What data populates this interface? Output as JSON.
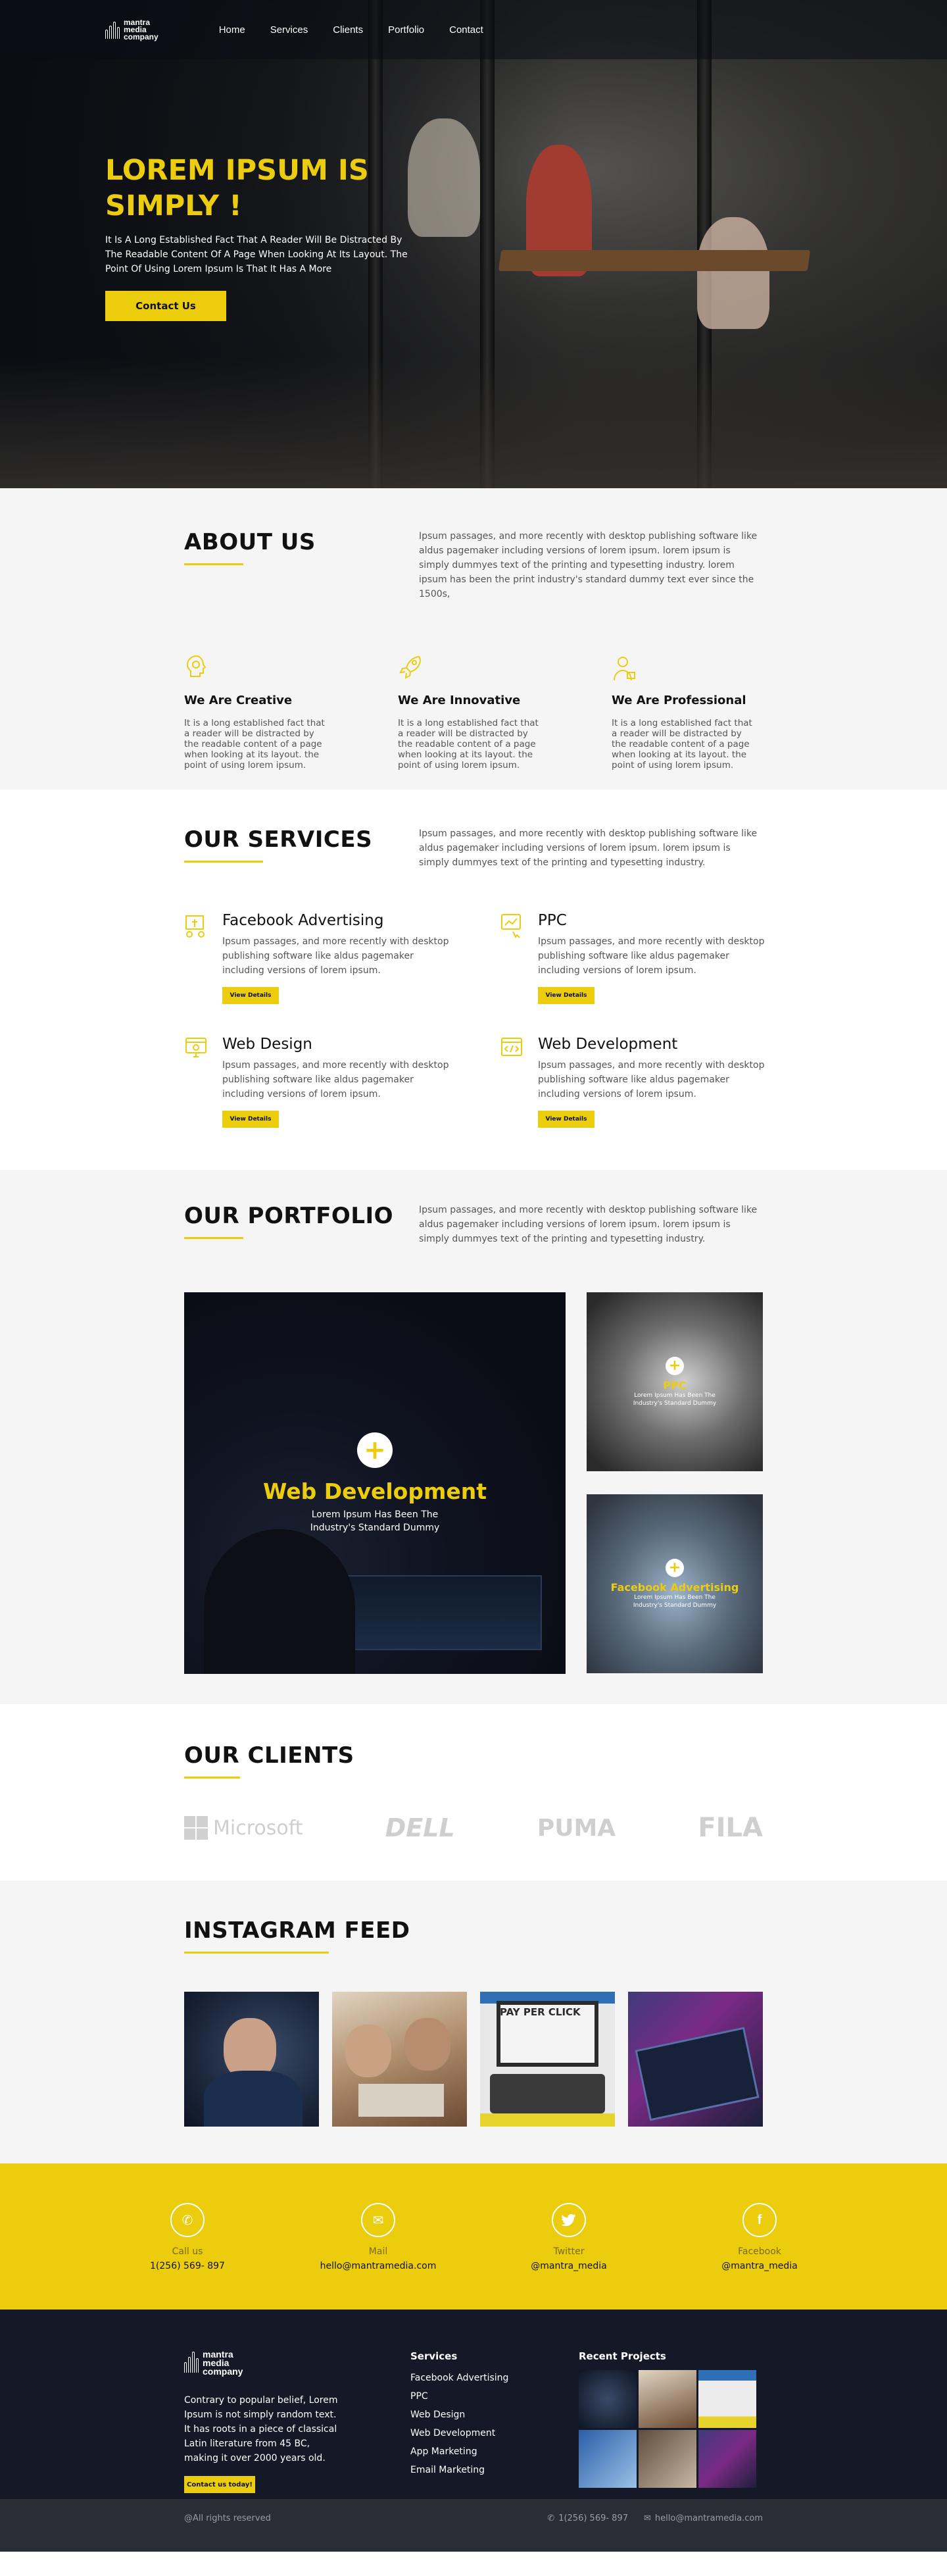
{
  "brand": {
    "logo_line1": "mantra",
    "logo_line2": "media",
    "logo_line3": "company"
  },
  "nav": {
    "items": [
      "Home",
      "Services",
      "Clients",
      "Portfolio",
      "Contact"
    ]
  },
  "hero": {
    "title_line1": "LOREM IPSUM IS",
    "title_line2": "SIMPLY !",
    "text": "It Is A Long Established Fact That A Reader Will Be Distracted By The Readable Content Of A Page When Looking At Its Layout. The Point Of Using Lorem Ipsum Is That It Has A More",
    "button": "Contact Us"
  },
  "about": {
    "title": "ABOUT US",
    "desc": "Ipsum passages, and more recently with desktop publishing software like aldus pagemaker including versions of lorem ipsum. lorem ipsum is simply dummyes text of the printing and typesetting industry. lorem ipsum has been the print industry's standard dummy text ever since the 1500s,",
    "features": [
      {
        "title": "We Are Creative",
        "icon": "lightbulb-head-icon",
        "text": "It is a long established fact that a reader will be distracted by the readable content of a page when looking at its layout. the point of using lorem ipsum."
      },
      {
        "title": "We Are Innovative",
        "icon": "rocket-icon",
        "text": "It is a long established fact that a reader will be distracted by the readable content of a page when looking at its layout. the point of using lorem ipsum."
      },
      {
        "title": "We Are Professional",
        "icon": "professional-person-icon",
        "text": "It is a long established fact that a reader will be distracted by the readable content of a page when looking at its layout. the point of using lorem ipsum."
      }
    ]
  },
  "services": {
    "title": "OUR SERVICES",
    "desc": "Ipsum passages, and more recently with desktop publishing software like aldus pagemaker including versions of lorem ipsum. lorem ipsum is simply dummyes text of the printing and typesetting industry.",
    "items": [
      {
        "title": "Facebook Advertising",
        "icon": "facebook-ads-icon",
        "text": "Ipsum passages, and more recently with desktop publishing software like aldus pagemaker including versions of lorem ipsum.",
        "button": "View Details"
      },
      {
        "title": "PPC",
        "icon": "ppc-icon",
        "text": "Ipsum passages, and more recently with desktop publishing software like aldus pagemaker including versions of lorem ipsum.",
        "button": "View Details"
      },
      {
        "title": "Web Design",
        "icon": "web-design-icon",
        "text": "Ipsum passages, and more recently with desktop publishing software like aldus pagemaker including versions of lorem ipsum.",
        "button": "View Details"
      },
      {
        "title": "Web Development",
        "icon": "web-development-icon",
        "text": "Ipsum passages, and more recently with desktop publishing software like aldus pagemaker including versions of lorem ipsum.",
        "button": "View Details"
      }
    ]
  },
  "portfolio": {
    "title": "OUR PORTFOLIO",
    "desc": "Ipsum passages, and more recently with desktop publishing software like aldus pagemaker including versions of lorem ipsum. lorem ipsum is simply dummyes text of the printing and typesetting industry.",
    "items": [
      {
        "title": "Web Development",
        "sub": "Lorem Ipsum Has Been The Industry's Standard Dummy"
      },
      {
        "title": "PPC",
        "sub": "Lorem Ipsum Has Been The Industry's Standard Dummy"
      },
      {
        "title": "Facebook Advertising",
        "sub": "Lorem Ipsum Has Been The Industry's Standard Dummy"
      }
    ]
  },
  "clients": {
    "title": "OUR CLIENTS",
    "logos": [
      "Microsoft",
      "DELL",
      "PUMA",
      "FILA"
    ]
  },
  "instagram": {
    "title": "INSTAGRAM FEED",
    "ppc_text": "PAY PER CLICK"
  },
  "contact": [
    {
      "label": "Call us",
      "value": "1(256) 569- 897",
      "icon": "phone-icon"
    },
    {
      "label": "Mail",
      "value": "hello@mantramedia.com",
      "icon": "mail-icon"
    },
    {
      "label": "Twitter",
      "value": "@mantra_media",
      "icon": "twitter-icon"
    },
    {
      "label": "Facebook",
      "value": "@mantra_media",
      "icon": "facebook-icon"
    }
  ],
  "footer": {
    "about": "Contrary to popular belief, Lorem Ipsum is not simply random text. It has roots in a piece of classical Latin literature from 45 BC, making it over 2000 years old.",
    "button": "Contact us today!",
    "services_head": "Services",
    "services": [
      "Facebook Advertising",
      "PPC",
      "Web Design",
      "Web Development",
      "App Marketing",
      "Email Marketing"
    ],
    "recent_head": "Recent Projects",
    "copyright": "@All rights reserved",
    "phone": "1(256) 569- 897",
    "email": "hello@mantramedia.com"
  },
  "colors": {
    "accent": "#ebcd0e",
    "dark": "#141827",
    "light_bg": "#f5f5f5"
  }
}
